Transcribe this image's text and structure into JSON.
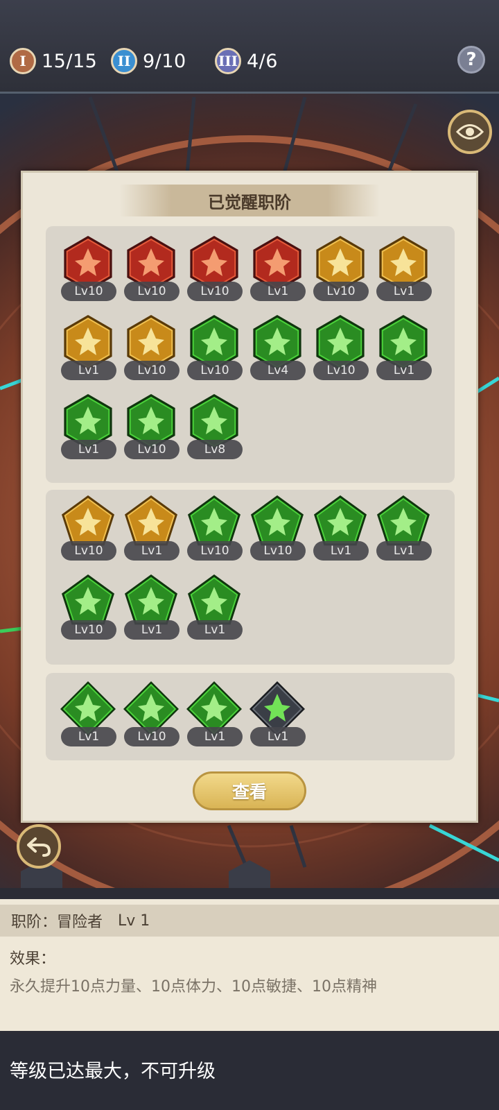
{
  "counters": [
    {
      "numeral": "I",
      "value": "15/15",
      "color": "#b06a45"
    },
    {
      "numeral": "II",
      "value": "9/10",
      "color": "#3b8fd1"
    },
    {
      "numeral": "III",
      "value": "4/6",
      "color": "#6a6fb5"
    }
  ],
  "help_label": "?",
  "panel": {
    "title": "已觉醒职阶",
    "view_button": "查看"
  },
  "tier1": [
    {
      "level": "Lv10",
      "color": "red",
      "icon": "axe-icon"
    },
    {
      "level": "Lv10",
      "color": "red",
      "icon": "crossed-swords-icon"
    },
    {
      "level": "Lv10",
      "color": "red",
      "icon": "flexed-arm-icon"
    },
    {
      "level": "Lv1",
      "color": "red",
      "icon": "knight-helmet-icon"
    },
    {
      "level": "Lv10",
      "color": "gold",
      "icon": "shield-sword-icon"
    },
    {
      "level": "Lv1",
      "color": "gold",
      "icon": "heart-cup-icon"
    },
    {
      "level": "Lv1",
      "color": "gold",
      "icon": "holy-shield-icon"
    },
    {
      "level": "Lv10",
      "color": "gold",
      "icon": "radiant-burst-icon"
    },
    {
      "level": "Lv10",
      "color": "green",
      "icon": "winged-dagger-icon"
    },
    {
      "level": "Lv4",
      "color": "green",
      "icon": "twin-wings-icon"
    },
    {
      "level": "Lv10",
      "color": "green",
      "icon": "serpent-staff-icon"
    },
    {
      "level": "Lv1",
      "color": "green",
      "icon": "bow-arrow-icon"
    },
    {
      "level": "Lv1",
      "color": "green",
      "icon": "claw-slash-icon"
    },
    {
      "level": "Lv10",
      "color": "green",
      "icon": "flame-eye-icon"
    },
    {
      "level": "Lv8",
      "color": "green",
      "icon": "wind-blade-icon"
    }
  ],
  "tier2": [
    {
      "level": "Lv10",
      "color": "gold",
      "icon": "fire-totem-icon"
    },
    {
      "level": "Lv1",
      "color": "gold",
      "icon": "crest-shield-icon"
    },
    {
      "level": "Lv10",
      "color": "green",
      "icon": "crossed-blades-icon"
    },
    {
      "level": "Lv10",
      "color": "green",
      "icon": "demon-wings-icon"
    },
    {
      "level": "Lv1",
      "color": "green",
      "icon": "crossbow-icon"
    },
    {
      "level": "Lv1",
      "color": "green",
      "icon": "beast-skull-icon"
    },
    {
      "level": "Lv10",
      "color": "green",
      "icon": "horned-mask-icon"
    },
    {
      "level": "Lv1",
      "color": "green",
      "icon": "vortex-icon"
    },
    {
      "level": "Lv1",
      "color": "green",
      "icon": "dragon-head-icon"
    }
  ],
  "tier3": [
    {
      "level": "Lv1",
      "color": "green",
      "icon": "phoenix-orb-icon"
    },
    {
      "level": "Lv10",
      "color": "green",
      "icon": "spirit-wings-icon"
    },
    {
      "level": "Lv1",
      "color": "green",
      "icon": "hooded-mage-icon"
    },
    {
      "level": "Lv1",
      "color": "dark",
      "icon": "dark-knight-helmet-icon"
    }
  ],
  "info": {
    "class_line": "职阶：冒险者",
    "class_level": "Lv 1",
    "effect_label": "效果：",
    "effect_text": "永久提升10点力量、10点体力、10点敏捷、10点精神"
  },
  "footer_text": "等级已达最大，不可升级"
}
